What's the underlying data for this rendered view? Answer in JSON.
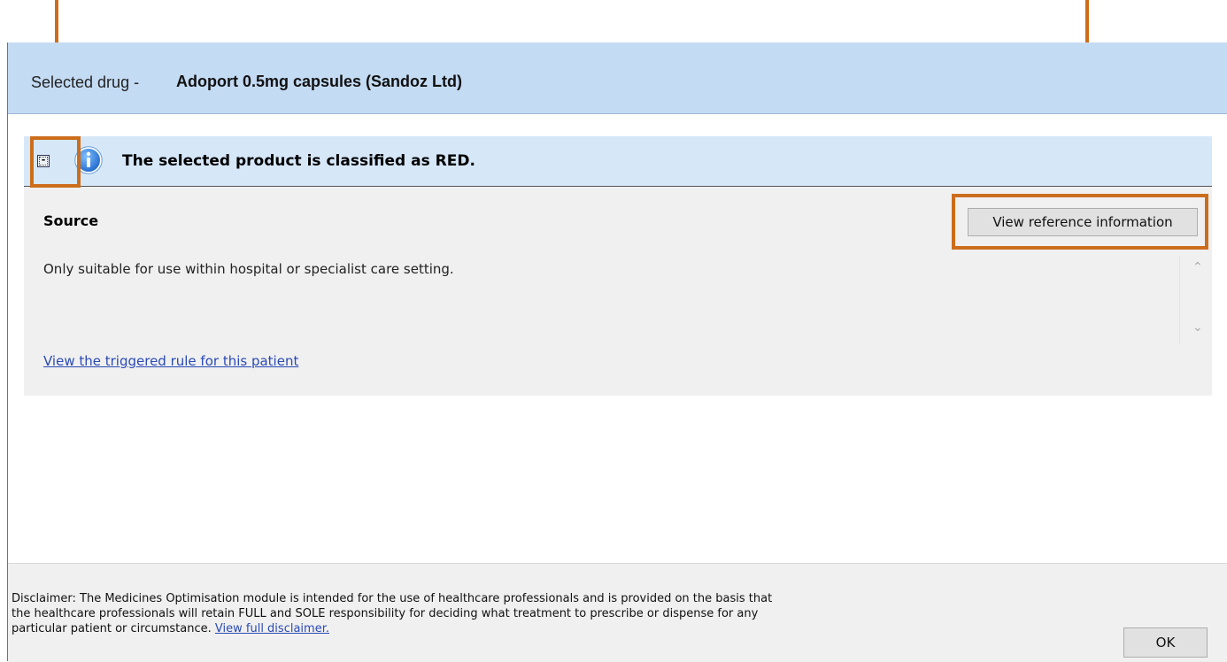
{
  "header": {
    "prefix": "Selected drug -",
    "drug_name": "Adoport 0.5mg capsules (Sandoz Ltd)"
  },
  "alert": {
    "collapse_symbol": "-",
    "title": "The selected product is classified as RED.",
    "icon": "info-icon"
  },
  "details": {
    "source_title": "Source",
    "reference_button": "View reference information",
    "description": "Only suitable for use within hospital or specialist care setting.",
    "rule_link": "View the triggered rule for this patient"
  },
  "footer": {
    "disclaimer": "Disclaimer: The Medicines Optimisation module is intended for the use of healthcare professionals and is provided on the basis that the healthcare professionals will retain FULL and SOLE responsibility for deciding what treatment to prescribe or dispense for any particular patient or circumstance.",
    "disclaimer_link": "View full disclaimer.",
    "ok_button": "OK"
  },
  "colors": {
    "accent_annotation": "#cc6d1c",
    "header_bg": "#c4dbf4",
    "alert_bg": "#d6e7f8",
    "link": "#2a4ab5"
  }
}
